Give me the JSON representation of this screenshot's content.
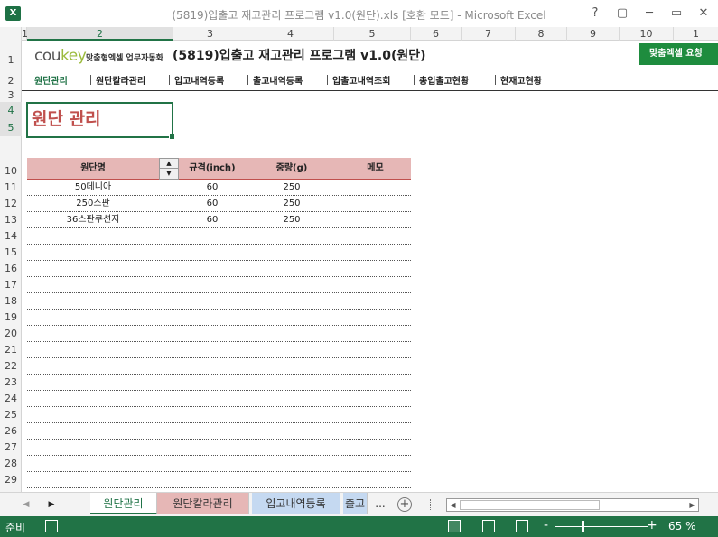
{
  "window": {
    "app_icon": "X",
    "title": "(5819)입출고 재고관리 프로그램 v1.0(원단).xls  [호환 모드] - Microsoft Excel",
    "controls": [
      "?",
      "▢",
      "─",
      "▭",
      "✕"
    ]
  },
  "columns": [
    "1",
    "2",
    "3",
    "4",
    "5",
    "6",
    "7",
    "8",
    "9",
    "10",
    "1"
  ],
  "rows": [
    "1",
    "2",
    "3",
    "4",
    "5",
    "",
    "",
    "",
    "10",
    "11",
    "12",
    "13",
    "14",
    "15",
    "16",
    "17",
    "18",
    "19",
    "20",
    "21",
    "22",
    "23",
    "24",
    "25",
    "26",
    "27",
    "28",
    "29"
  ],
  "header": {
    "logo_main": "cou",
    "logo_accent": "key",
    "logo_sub": "맞춤형엑셀 업무자동화",
    "app_title": "(5819)입출고 재고관리 프로그램 v1.0(원단)",
    "custom_button": "맞춤엑셀 요청"
  },
  "nav": [
    {
      "label": "원단관리",
      "active": true
    },
    {
      "label": "원단칼라관리",
      "active": false
    },
    {
      "label": "입고내역등록",
      "active": false
    },
    {
      "label": "출고내역등록",
      "active": false
    },
    {
      "label": "입출고내역조회",
      "active": false
    },
    {
      "label": "총입출고현황",
      "active": false
    },
    {
      "label": "현재고현황",
      "active": false
    }
  ],
  "page_heading": "원단 관리",
  "table": {
    "headers": [
      "원단명",
      "규격(inch)",
      "중량(g)",
      "메모"
    ],
    "rows": [
      [
        "50데니아",
        "60",
        "250",
        ""
      ],
      [
        "250스판",
        "60",
        "250",
        ""
      ],
      [
        "36스판쿠션지",
        "60",
        "250",
        ""
      ]
    ]
  },
  "sheet_tabs": [
    {
      "label": "원단관리",
      "active": true
    },
    {
      "label": "원단칼라관리",
      "active": false
    },
    {
      "label": "입고내역등록",
      "active": false
    },
    {
      "label": "출고",
      "active": false
    }
  ],
  "sheet_tab_more": "...",
  "status": {
    "text": "준비",
    "zoom": "65 %",
    "zoom_minus": "-",
    "zoom_plus": "+"
  }
}
